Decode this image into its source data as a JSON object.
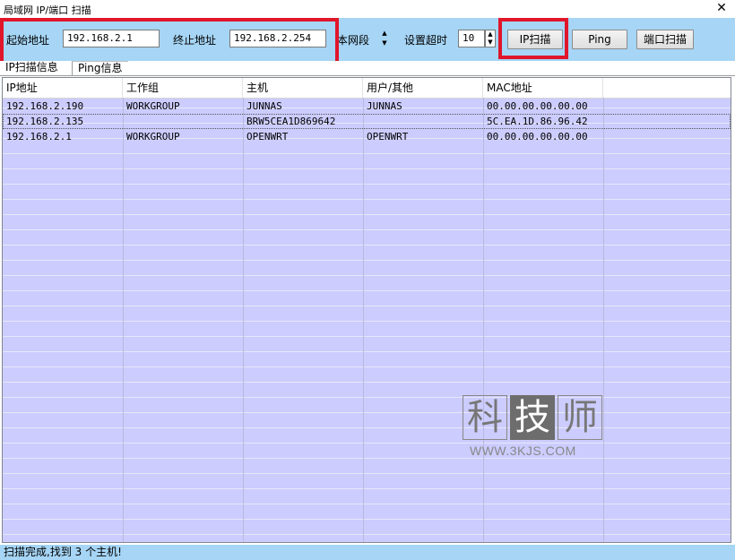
{
  "window": {
    "title": "局域网 IP/端口 扫描",
    "close_glyph": "✕"
  },
  "toolbar": {
    "start_label": "起始地址",
    "start_value": "192.168.2.1",
    "end_label": "终止地址",
    "end_value": "192.168.2.254",
    "segment_label": "本网段",
    "timeout_label": "设置超时",
    "timeout_value": "10",
    "ip_scan_button": "IP扫描",
    "ping_button": "Ping",
    "port_scan_button": "端口扫描"
  },
  "tabs": [
    {
      "label": "IP扫描信息",
      "active": true
    },
    {
      "label": "Ping信息",
      "active": false
    }
  ],
  "table": {
    "columns": [
      "IP地址",
      "工作组",
      "主机",
      "用户/其他",
      "MAC地址"
    ],
    "rows": [
      [
        "192.168.2.190",
        "WORKGROUP",
        "JUNNAS",
        "JUNNAS",
        "00.00.00.00.00.00"
      ],
      [
        "192.168.2.135",
        "",
        "BRW5CEA1D869642",
        "",
        "5C.EA.1D.86.96.42"
      ],
      [
        "192.168.2.1",
        "WORKGROUP",
        "OPENWRT",
        "OPENWRT",
        "00.00.00.00.00.00"
      ]
    ]
  },
  "watermark": {
    "chars": [
      "科",
      "技",
      "师"
    ],
    "url": "WWW.3KJS.COM"
  },
  "status": {
    "text": "扫描完成,找到 3 个主机!"
  },
  "colors": {
    "toolbar_bg": "#a6d5f5",
    "list_bg": "#ccccff",
    "highlight_box": "#e0162b"
  }
}
